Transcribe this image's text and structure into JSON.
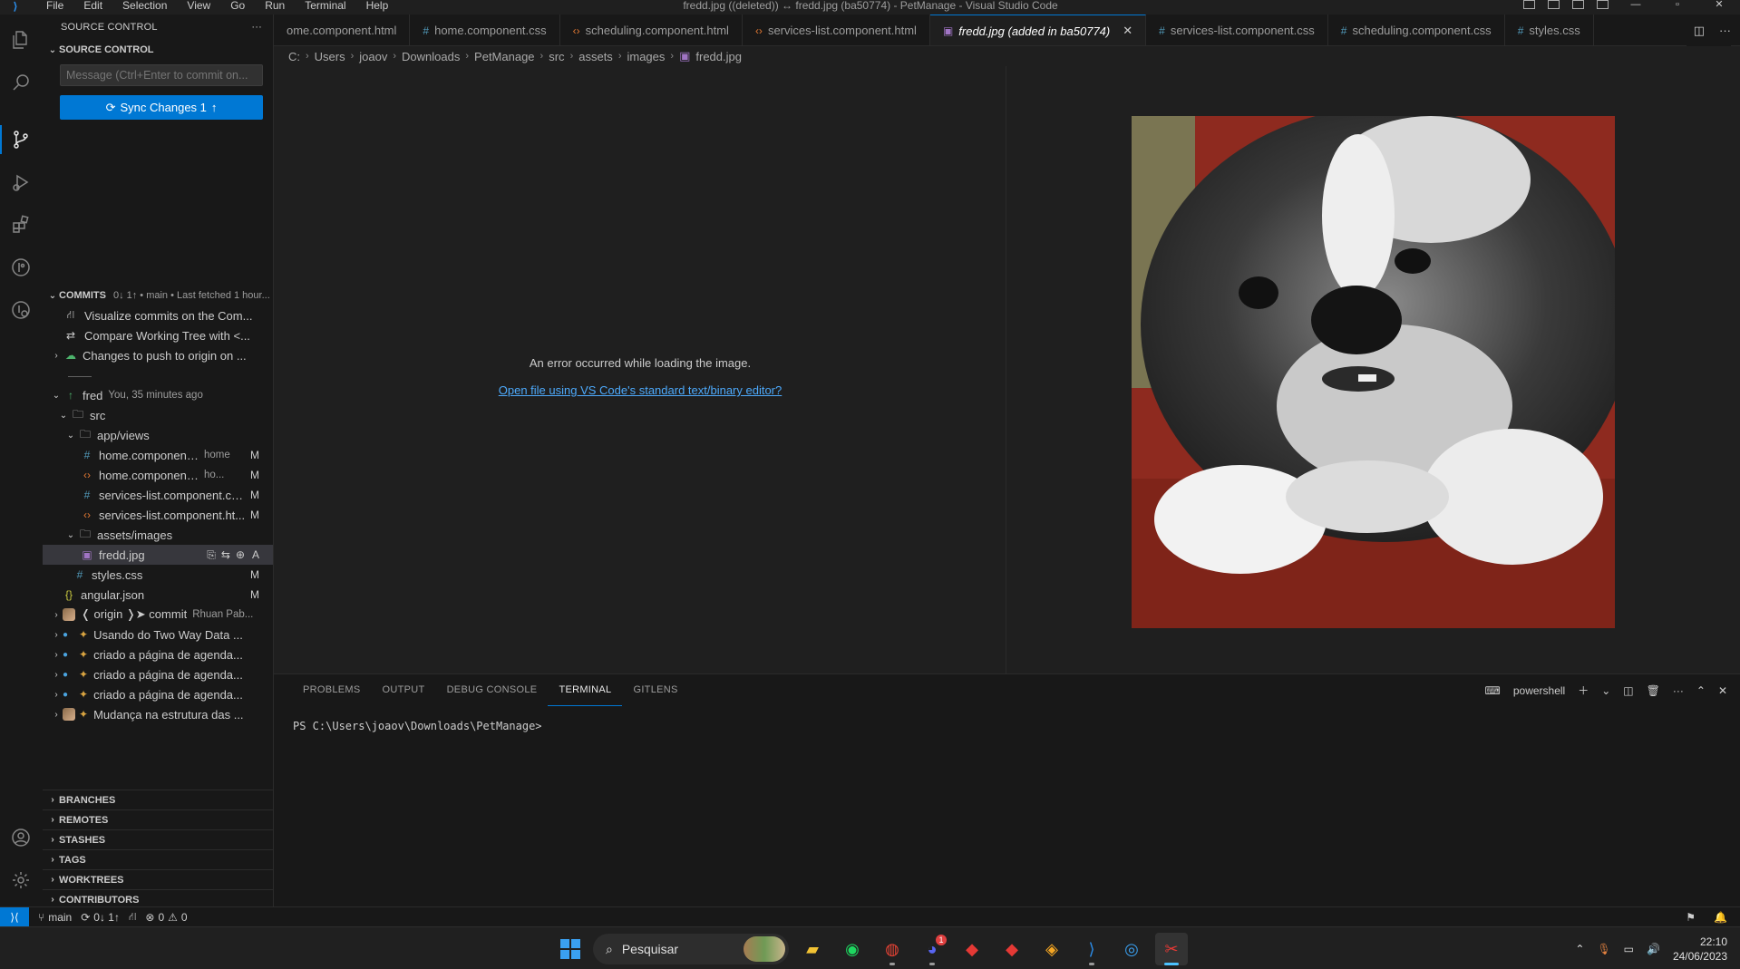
{
  "titlebar": {
    "menu": [
      "File",
      "Edit",
      "Selection",
      "View",
      "Go",
      "Run",
      "Terminal",
      "Help"
    ],
    "title": "fredd.jpg ((deleted)) ↔ fredd.jpg (ba50774) - PetManage - Visual Studio Code"
  },
  "sidebar": {
    "header": "SOURCE CONTROL",
    "section_title": "SOURCE CONTROL",
    "commit_placeholder": "Message (Ctrl+Enter to commit on...",
    "sync_label": "Sync Changes 1",
    "commits": {
      "title": "COMMITS",
      "subtitle": "0↓ 1↑ • main • Last fetched 1 hour...",
      "actions": [
        "Visualize commits on the Com...",
        "Compare Working Tree with <...",
        "Changes to push to origin on ..."
      ],
      "current_commit": {
        "name": "fred",
        "desc": "You, 35 minutes ago"
      },
      "tree": [
        {
          "label": "src",
          "type": "folder",
          "depth": 1
        },
        {
          "label": "app/views",
          "type": "folder",
          "depth": 2
        },
        {
          "label": "home.component.css",
          "desc": "home",
          "type": "css",
          "status": "M",
          "depth": 3
        },
        {
          "label": "home.component.html",
          "desc": "ho...",
          "type": "html",
          "status": "M",
          "depth": 3
        },
        {
          "label": "services-list.component.css...",
          "desc": "",
          "type": "css",
          "status": "M",
          "depth": 3
        },
        {
          "label": "services-list.component.ht...",
          "desc": "",
          "type": "html",
          "status": "M",
          "depth": 3
        },
        {
          "label": "assets/images",
          "type": "folder",
          "depth": 2
        },
        {
          "label": "fredd.jpg",
          "type": "img",
          "status": "A",
          "depth": 3,
          "selected": true
        },
        {
          "label": "styles.css",
          "type": "css",
          "status": "M",
          "depth": 2
        },
        {
          "label": "angular.json",
          "type": "json",
          "status": "M",
          "depth": 1
        }
      ],
      "history": [
        {
          "label": "❬ origin ❭➤  commit",
          "desc": "Rhuan Pab..."
        },
        {
          "label": "Usando do Two Way Data ...",
          "desc": ""
        },
        {
          "label": "criado a página de agenda...",
          "desc": ""
        },
        {
          "label": "criado a página de agenda...",
          "desc": ""
        },
        {
          "label": "criado a página de agenda...",
          "desc": ""
        },
        {
          "label": "Mudança na estrutura das ...",
          "desc": ""
        }
      ]
    },
    "bottom_sections": [
      "BRANCHES",
      "REMOTES",
      "STASHES",
      "TAGS",
      "WORKTREES",
      "CONTRIBUTORS"
    ]
  },
  "tabs": [
    {
      "label": "ome.component.html",
      "type": "html"
    },
    {
      "label": "home.component.css",
      "type": "css"
    },
    {
      "label": "scheduling.component.html",
      "type": "html"
    },
    {
      "label": "services-list.component.html",
      "type": "html"
    },
    {
      "label": "fredd.jpg (added in ba50774)",
      "type": "img",
      "active": true
    },
    {
      "label": "services-list.component.css",
      "type": "css"
    },
    {
      "label": "scheduling.component.css",
      "type": "css"
    },
    {
      "label": "styles.css",
      "type": "css"
    }
  ],
  "breadcrumb": [
    "C:",
    "Users",
    "joaov",
    "Downloads",
    "PetManage",
    "src",
    "assets",
    "images",
    "fredd.jpg"
  ],
  "editor": {
    "error_message": "An error occurred while loading the image.",
    "error_link": "Open file using VS Code's standard text/binary editor?"
  },
  "panel": {
    "tabs": [
      "PROBLEMS",
      "OUTPUT",
      "DEBUG CONSOLE",
      "TERMINAL",
      "GITLENS"
    ],
    "active_tab": "TERMINAL",
    "shell": "powershell",
    "prompt": "PS C:\\Users\\joaov\\Downloads\\PetManage>"
  },
  "statusbar": {
    "branch": "main",
    "sync": "0↓ 1↑",
    "errors": "0",
    "warnings": "0"
  },
  "taskbar": {
    "search_placeholder": "Pesquisar",
    "time": "22:10",
    "date": "24/06/2023",
    "discord_badge": "1"
  },
  "colors": {
    "accent": "#0078d4",
    "link": "#4daafc",
    "background": "#1f1f1f"
  }
}
